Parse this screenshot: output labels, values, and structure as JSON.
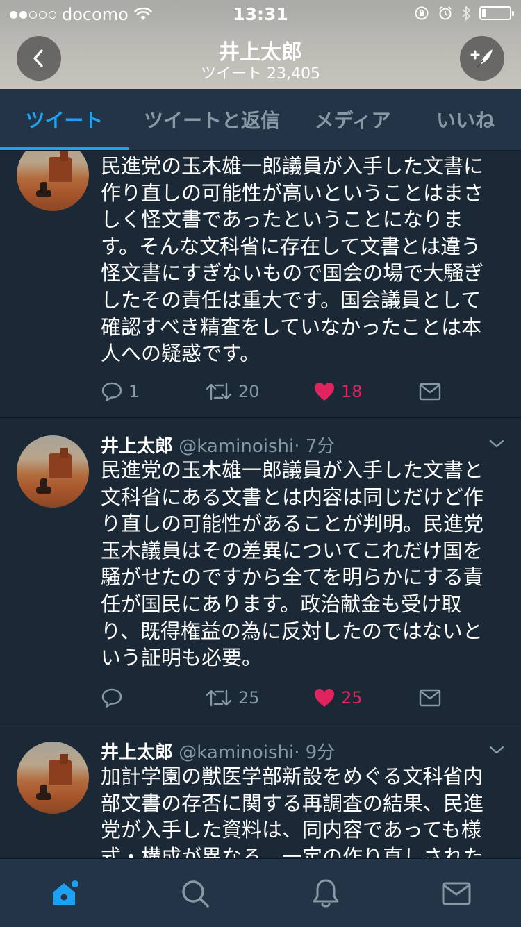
{
  "status_bar": {
    "carrier": "docomo",
    "time": "13:31"
  },
  "header": {
    "title": "井上太郎",
    "subtitle": "ツイート 23,405"
  },
  "tabs": [
    {
      "label": "ツイート",
      "active": true
    },
    {
      "label": "ツイートと返信",
      "active": false
    },
    {
      "label": "メディア",
      "active": false
    },
    {
      "label": "いいね",
      "active": false
    }
  ],
  "tweets": [
    {
      "name": "",
      "handle": "",
      "time": "",
      "text": "民進党の玉木雄一郎議員が入手した文書に\n作り直しの可能性が高いということはまさ\nしく怪文書であったということになりま\nす。そんな文科省に存在して文書とは違う\n怪文書にすぎないもので国会の場で大騒ぎ\nしたその責任は重大です。国会議員として\n確認すべき精査をしていなかったことは本\n人への疑惑です。",
      "replies": "1",
      "retweets": "20",
      "likes": "18",
      "liked": true
    },
    {
      "name": "井上太郎",
      "handle": "@kaminoishi",
      "time": "· 7分",
      "text": "民進党の玉木雄一郎議員が入手した文書と\n文科省にある文書とは内容は同じだけど作\nり直しの可能性があることが判明。民進党\n玉木議員はその差異についてこれだけ国を\n騒がせたのですから全てを明らかにする責\n任が国民にあります。政治献金も受け取\nり、既得権益の為に反対したのではないと\nいう証明も必要。",
      "replies": "",
      "retweets": "25",
      "likes": "25",
      "liked": true
    },
    {
      "name": "井上太郎",
      "handle": "@kaminoishi",
      "time": "· 9分",
      "text": "加計学園の獣医学部新設をめぐる文科省内\n部文書の存否に関する再調査の結果、民進\n党が入手した資料は、同内容であっても様\n式・構成が異なる、一定の作り直しされた"
    }
  ],
  "bottom_nav": [
    {
      "icon": "home-icon",
      "active": true
    },
    {
      "icon": "search-icon",
      "active": false
    },
    {
      "icon": "bell-icon",
      "active": false
    },
    {
      "icon": "mail-icon",
      "active": false
    }
  ],
  "colors": {
    "accent": "#1da1f2",
    "like": "#e0245e",
    "background": "#1b2836",
    "bar": "#243447",
    "secondary_text": "#8899a6"
  }
}
